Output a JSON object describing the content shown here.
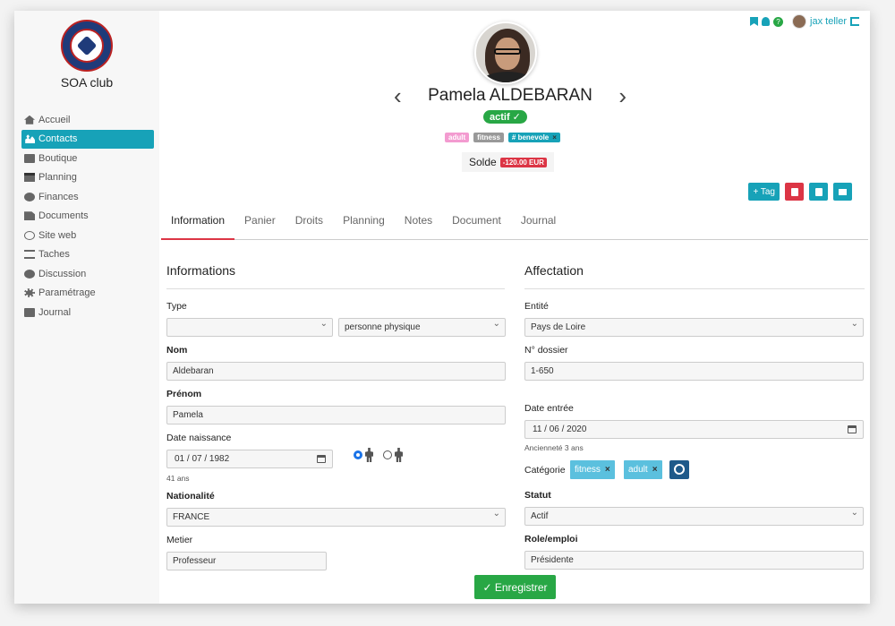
{
  "sidebar": {
    "club_name": "SOA club",
    "items": [
      {
        "label": "Accueil",
        "icon": "home-icon"
      },
      {
        "label": "Contacts",
        "icon": "users-icon",
        "active": true
      },
      {
        "label": "Boutique",
        "icon": "box-icon"
      },
      {
        "label": "Planning",
        "icon": "calendar-icon"
      },
      {
        "label": "Finances",
        "icon": "piggy-bank-icon"
      },
      {
        "label": "Documents",
        "icon": "document-icon"
      },
      {
        "label": "Site web",
        "icon": "globe-icon"
      },
      {
        "label": "Taches",
        "icon": "list-icon"
      },
      {
        "label": "Discussion",
        "icon": "dollar-icon"
      },
      {
        "label": "Paramétrage",
        "icon": "gear-icon"
      },
      {
        "label": "Journal",
        "icon": "book-icon"
      }
    ]
  },
  "header": {
    "user": "jax teller",
    "help": "?"
  },
  "profile": {
    "name": "Pamela ALDEBARAN",
    "status": "actif ✓",
    "tags": [
      "adult",
      "fitness",
      "# benevole"
    ],
    "tag_remove": "×",
    "solde_label": "Solde",
    "solde_value": "-120.00 EUR",
    "prev": "‹",
    "next": "›"
  },
  "actions": {
    "tag": "+ Tag"
  },
  "tabs": [
    "Information",
    "Panier",
    "Droits",
    "Planning",
    "Notes",
    "Document",
    "Journal"
  ],
  "informations": {
    "title": "Informations",
    "type_label": "Type",
    "type_value1": "",
    "type_value2": "personne physique",
    "nom_label": "Nom",
    "nom_value": "Aldebaran",
    "prenom_label": "Prénom",
    "prenom_value": "Pamela",
    "naissance_label": "Date naissance",
    "naissance_value": "01 / 07 / 1982",
    "age": "41 ans",
    "nationalite_label": "Nationalité",
    "nationalite_value": "FRANCE",
    "metier_label": "Metier",
    "metier_value": "Professeur"
  },
  "affectation": {
    "title": "Affectation",
    "entite_label": "Entité",
    "entite_value": "Pays de Loire",
    "dossier_label": "N° dossier",
    "dossier_value": "1-650",
    "entree_label": "Date entrée",
    "entree_value": "11 / 06 / 2020",
    "anciennete": "Ancienneté 3 ans",
    "categorie_label": "Catégorie",
    "categories": [
      "fitness",
      "adult"
    ],
    "chip_remove": "×",
    "statut_label": "Statut",
    "statut_value": "Actif",
    "role_label": "Role/emploi",
    "role_value": "Présidente"
  },
  "save_label": "✓ Enregistrer"
}
